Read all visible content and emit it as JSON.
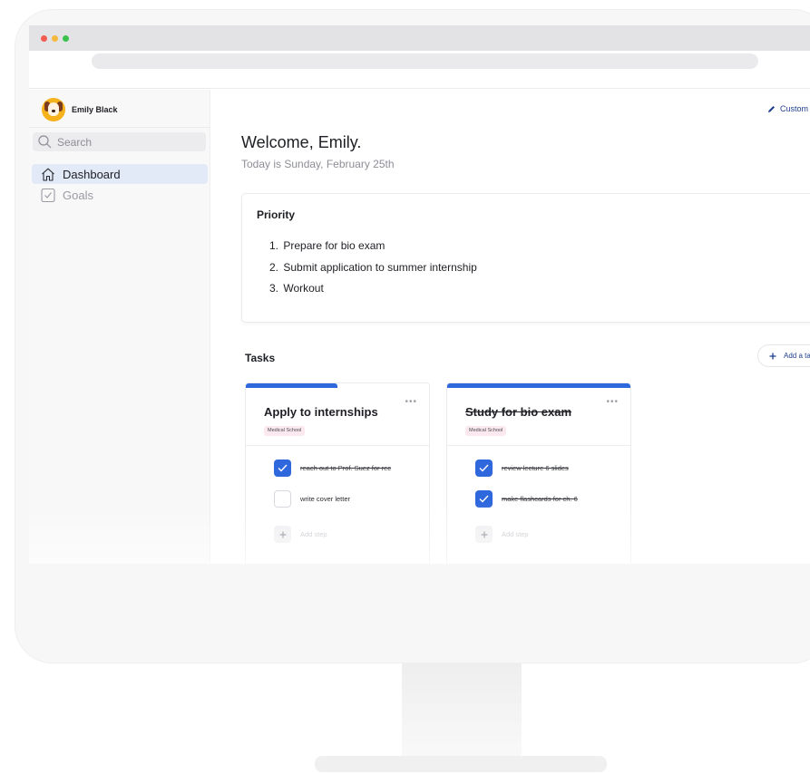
{
  "user": {
    "name": "Emily Black",
    "avatar_icon": "dog-avatar-icon"
  },
  "sidebar": {
    "search_placeholder": "Search",
    "items": [
      {
        "label": "Dashboard",
        "icon": "home-icon",
        "active": true
      },
      {
        "label": "Goals",
        "icon": "checkbox-icon",
        "active": false
      }
    ]
  },
  "header": {
    "customize_label": "Custom"
  },
  "main": {
    "welcome": "Welcome, Emily.",
    "today": "Today is Sunday, February 25th"
  },
  "priority": {
    "title": "Priority",
    "items": [
      {
        "num": "1.",
        "text": "Prepare for bio exam"
      },
      {
        "num": "2.",
        "text": "Submit application to summer internship"
      },
      {
        "num": "3.",
        "text": "Workout"
      }
    ]
  },
  "tasks": {
    "title": "Tasks",
    "add_label": "Add a ta",
    "cards": [
      {
        "title": "Apply to internships",
        "done": false,
        "progress": 0.5,
        "tag": "Medical School",
        "steps": [
          {
            "text": "reach out to Prof. Suez for rec",
            "done": true
          },
          {
            "text": "write cover letter",
            "done": false
          }
        ],
        "add_step": "Add step"
      },
      {
        "title": "Study for bio exam",
        "done": true,
        "progress": 1.0,
        "tag": "Medical School",
        "steps": [
          {
            "text": "review lecture 6 slides",
            "done": true
          },
          {
            "text": "make flashcards for ch. 6",
            "done": true
          }
        ],
        "add_step": "Add step"
      }
    ]
  },
  "colors": {
    "accent": "#2f67dd",
    "tag_bg": "#fbe9ef",
    "avatar": "#f6b21c"
  }
}
